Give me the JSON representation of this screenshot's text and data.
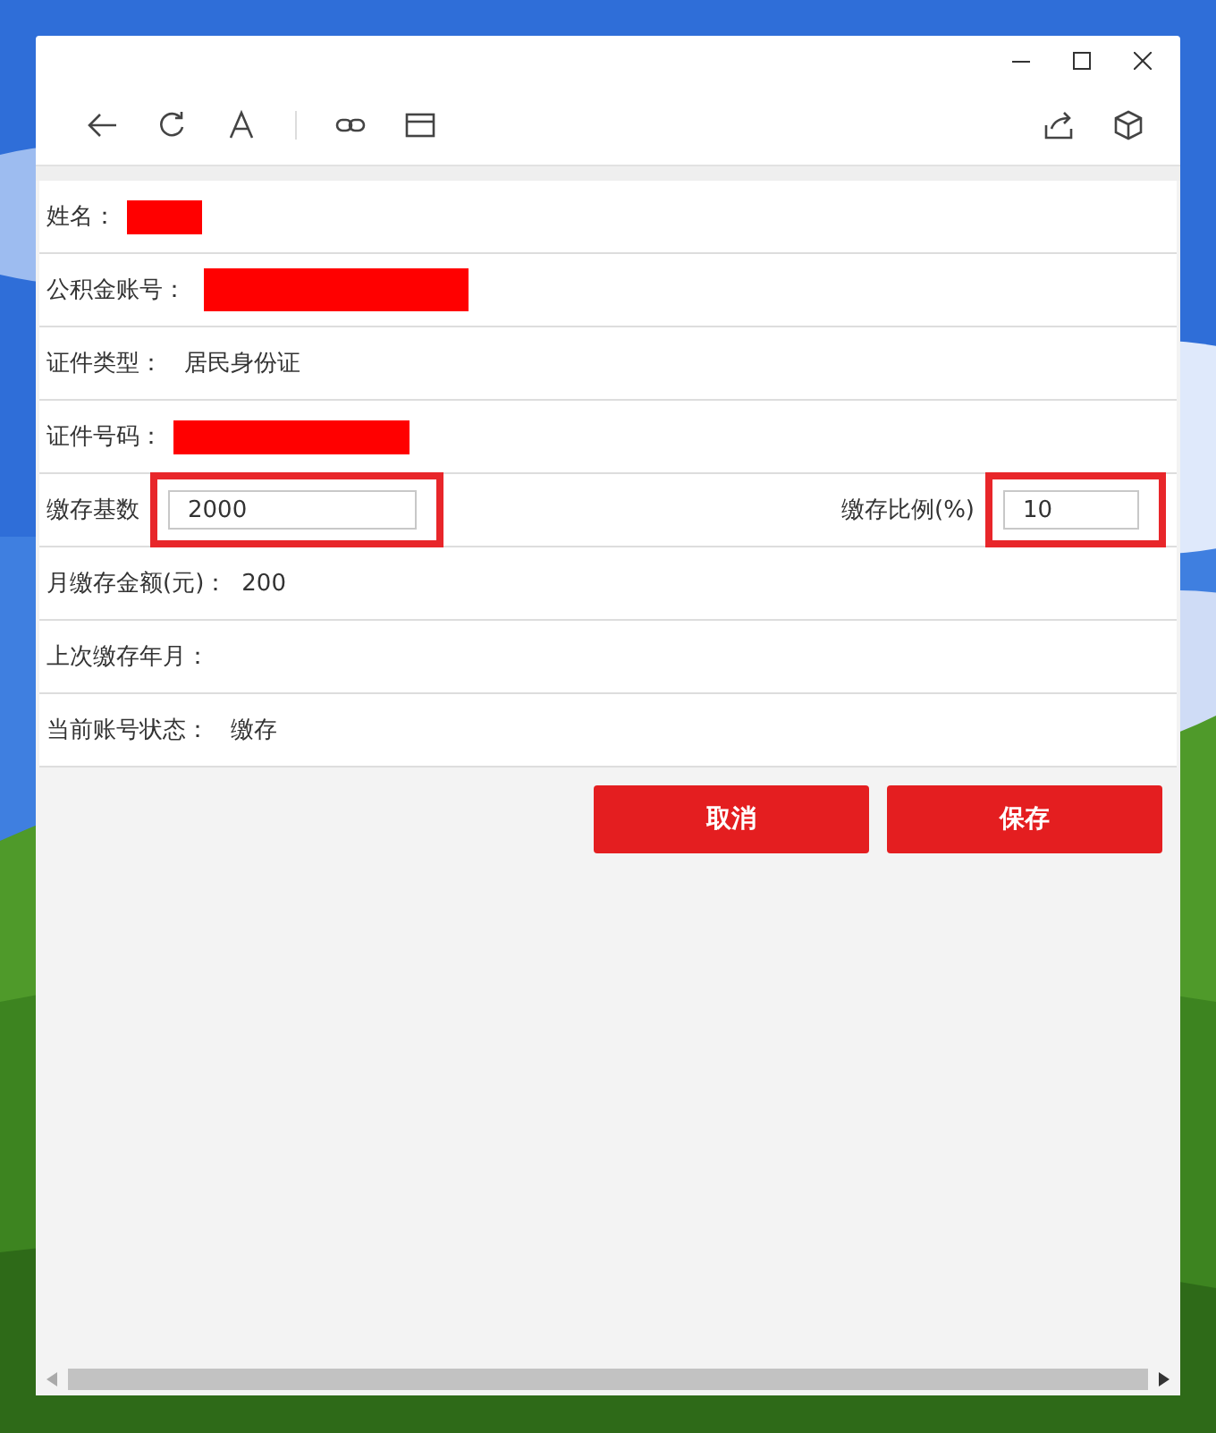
{
  "window": {
    "controls": [
      {
        "kind": "minimize"
      },
      {
        "kind": "maximize"
      },
      {
        "kind": "close"
      }
    ]
  },
  "toolbar": {
    "left": [
      {
        "kind": "back"
      },
      {
        "kind": "refresh"
      },
      {
        "kind": "font"
      },
      {
        "kind": "separator"
      },
      {
        "kind": "link"
      },
      {
        "kind": "window"
      }
    ],
    "right": [
      {
        "kind": "share"
      },
      {
        "kind": "cube"
      }
    ]
  },
  "form_rows": [
    {
      "kind": "redacted",
      "label": "姓名："
    },
    {
      "kind": "redacted",
      "label": "公积金账号："
    },
    {
      "kind": "text",
      "label": "证件类型：",
      "value": "居民身份证"
    },
    {
      "kind": "redacted",
      "label": "证件号码："
    },
    {
      "kind": "inputs",
      "fields": [
        {
          "label": "缴存基数",
          "value": "2000",
          "highlighted": true
        },
        {
          "label": "缴存比例(%)",
          "value": "10",
          "highlighted": true
        }
      ]
    },
    {
      "kind": "text",
      "label": "月缴存金额(元)：",
      "value": "200"
    },
    {
      "kind": "text",
      "label": "上次缴存年月："
    },
    {
      "kind": "text",
      "label": "当前账号状态：",
      "value": "缴存"
    }
  ],
  "buttons": [
    {
      "label": "取消"
    },
    {
      "label": "保存"
    }
  ]
}
